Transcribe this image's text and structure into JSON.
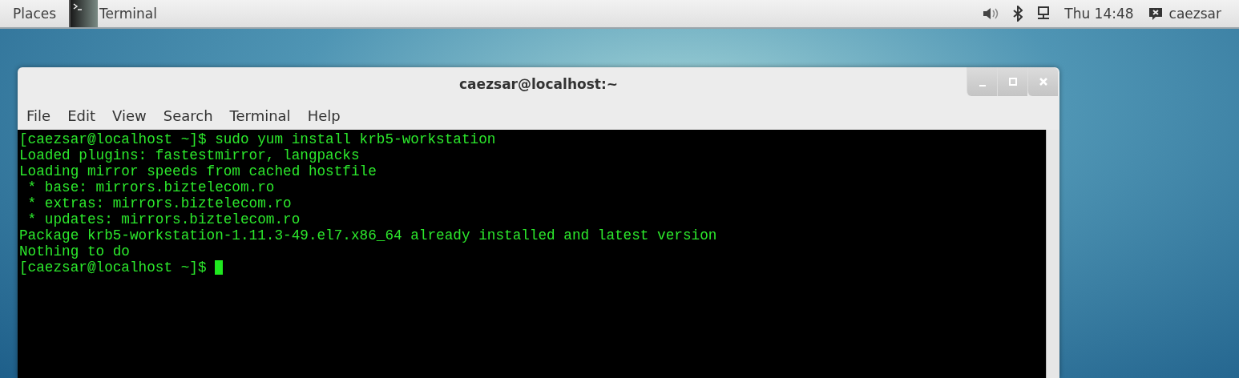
{
  "top_bar": {
    "places": "Places",
    "app": "Terminal",
    "clock": "Thu 14:48",
    "user": "caezsar"
  },
  "window": {
    "title": "caezsar@localhost:~",
    "menu": [
      "File",
      "Edit",
      "View",
      "Search",
      "Terminal",
      "Help"
    ],
    "terminal_lines": [
      "[caezsar@localhost ~]$ sudo yum install krb5-workstation",
      "Loaded plugins: fastestmirror, langpacks",
      "Loading mirror speeds from cached hostfile",
      " * base: mirrors.biztelecom.ro",
      " * extras: mirrors.biztelecom.ro",
      " * updates: mirrors.biztelecom.ro",
      "Package krb5-workstation-1.11.3-49.el7.x86_64 already installed and latest version",
      "Nothing to do",
      "[caezsar@localhost ~]$ "
    ]
  }
}
